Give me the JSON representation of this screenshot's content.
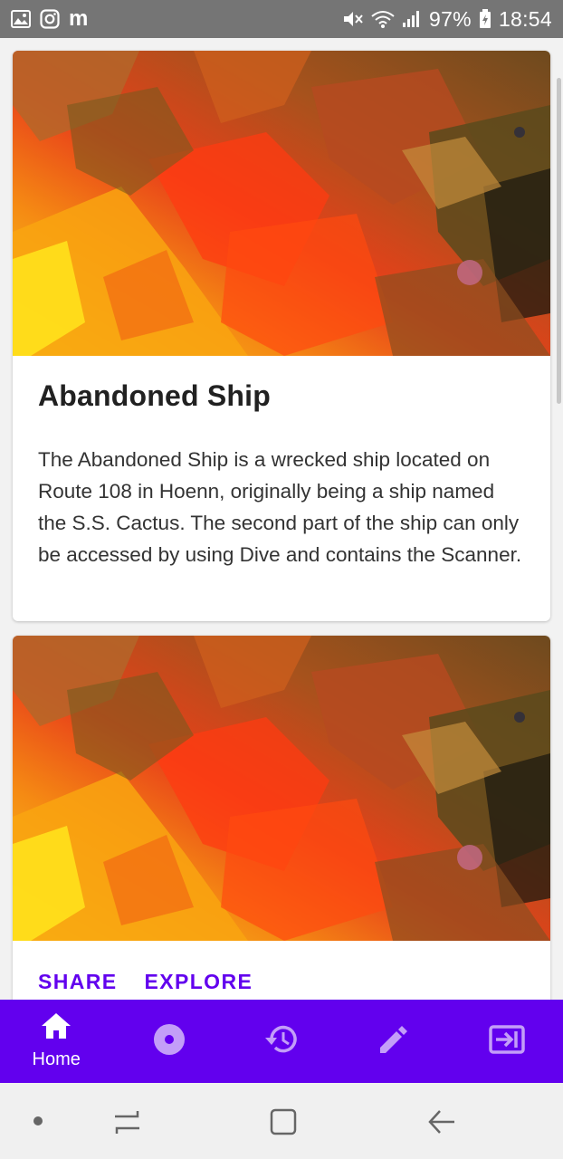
{
  "status_bar": {
    "left_icons": [
      "gallery-icon",
      "instagram-icon",
      "gmail-icon"
    ],
    "left_text_icon": "m",
    "right_icons": [
      "mute-icon",
      "wifi-icon",
      "signal-icon",
      "battery-icon"
    ],
    "battery": "97%",
    "time": "18:54"
  },
  "cards": [
    {
      "image": "abandoned-ship-image",
      "title": "Abandoned Ship",
      "text": "The Abandoned Ship is a wrecked ship located on Route 108 in Hoenn, originally being a ship named the S.S. Cactus. The second part of the ship can only be accessed by using Dive and contains the Scanner."
    },
    {
      "image": "abandoned-ship-image",
      "actions": [
        "SHARE",
        "EXPLORE"
      ]
    }
  ],
  "bottom_nav": {
    "items": [
      {
        "icon": "home-icon",
        "label": "Home",
        "active": true
      },
      {
        "icon": "disc-icon",
        "label": "",
        "active": false
      },
      {
        "icon": "history-icon",
        "label": "",
        "active": false
      },
      {
        "icon": "edit-icon",
        "label": "",
        "active": false
      },
      {
        "icon": "exit-icon",
        "label": "",
        "active": false
      }
    ]
  },
  "colors": {
    "primary": "#6200ee",
    "status_bar": "#757575",
    "card_title": "#212121"
  }
}
